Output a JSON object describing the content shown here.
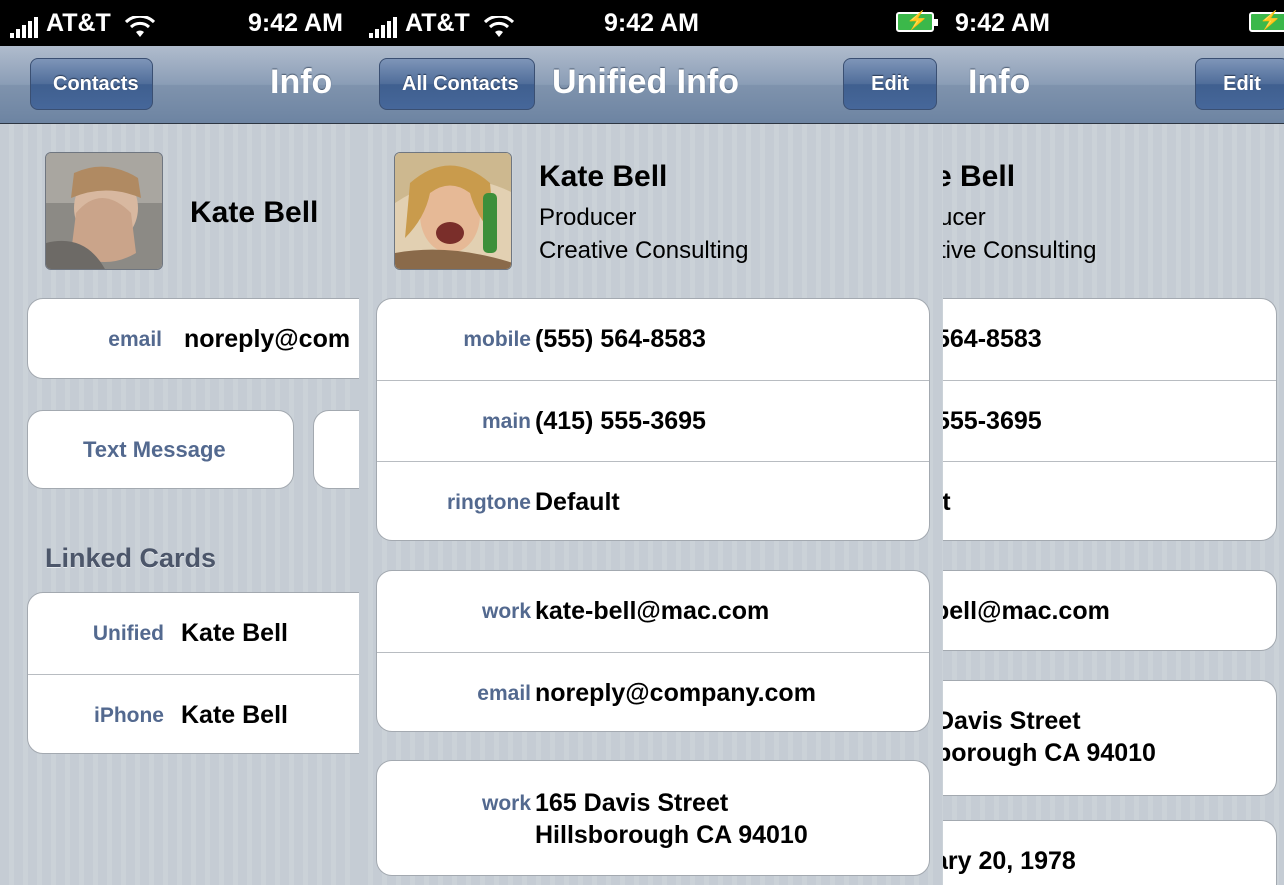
{
  "status": {
    "carrier": "AT&T",
    "time": "9:42 AM"
  },
  "screen1": {
    "nav": {
      "back_label": "Contacts",
      "title": "Info"
    },
    "name": "Kate Bell",
    "email_row": {
      "label": "email",
      "value": "noreply@com"
    },
    "text_message_label": "Text Message",
    "linked_header": "Linked Cards",
    "linked": [
      {
        "label": "Unified",
        "value": "Kate Bell"
      },
      {
        "label": "iPhone",
        "value": "Kate Bell"
      }
    ]
  },
  "screen2": {
    "nav": {
      "back_label": "All Contacts",
      "title": "Unified Info",
      "edit_label": "Edit"
    },
    "name": "Kate Bell",
    "job_title": "Producer",
    "company": "Creative Consulting",
    "group1": [
      {
        "label": "mobile",
        "value": "(555) 564-8583"
      },
      {
        "label": "main",
        "value": "(415) 555-3695"
      },
      {
        "label": "ringtone",
        "value": "Default"
      }
    ],
    "group2": [
      {
        "label": "work",
        "value": "kate-bell@mac.com"
      },
      {
        "label": "email",
        "value": "noreply@company.com"
      }
    ],
    "address": {
      "label": "work",
      "line1": "165 Davis Street",
      "line2": "Hillsborough CA 94010"
    }
  },
  "screen3": {
    "nav": {
      "title": "Info",
      "edit_label": "Edit"
    },
    "name": "e Bell",
    "job_title": "ucer",
    "company": "tive Consulting",
    "group1": [
      "564-8583",
      "555-3695",
      "ult"
    ],
    "email": "bell@mac.com",
    "address": {
      "line1": "Davis Street",
      "line2": "borough CA 94010"
    },
    "birthday": "ary 20, 1978"
  },
  "colors": {
    "label_blue": "#53698f",
    "nav_blue": "#6d84a2",
    "stripe_bg": "#c5ccd4"
  }
}
